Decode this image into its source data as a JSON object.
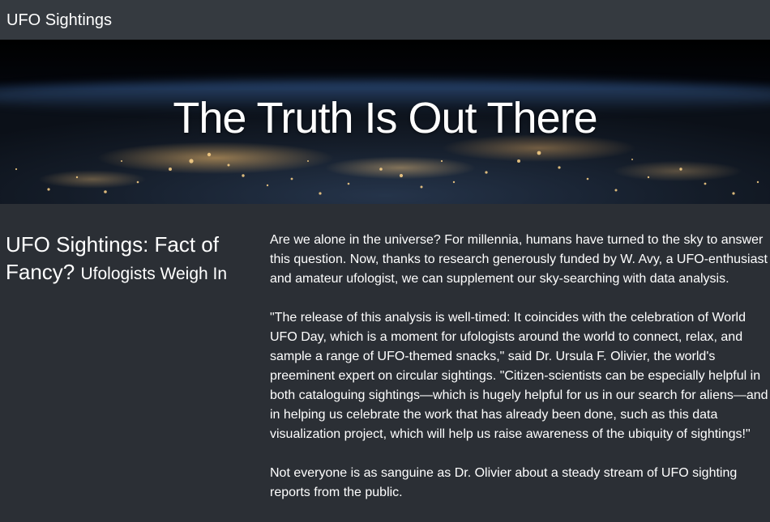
{
  "navbar": {
    "brand": "UFO Sightings"
  },
  "hero": {
    "title": "The Truth Is Out There"
  },
  "sidebar": {
    "heading": "UFO Sightings: Fact of Fancy?",
    "subheading": "Ufologists Weigh In"
  },
  "article": {
    "paragraphs": [
      "Are we alone in the universe? For millennia, humans have turned to the sky to answer this question. Now, thanks to research generously funded by W. Avy, a UFO-enthusiast and amateur ufologist, we can supplement our sky-searching with data analysis.",
      "\"The release of this analysis is well-timed: It coincides with the celebration of World UFO Day, which is a moment for ufologists around the world to connect, relax, and sample a range of UFO-themed snacks,\" said Dr. Ursula F. Olivier, the world's preeminent expert on circular sightings. \"Citizen-scientists can be especially helpful in both cataloguing sightings—which is hugely helpful for us in our search for aliens—and in helping us celebrate the work that has already been done, such as this data visualization project, which will help us raise awareness of the ubiquity of sightings!\"",
      "Not everyone is as sanguine as Dr. Olivier about a steady stream of UFO sighting reports from the public."
    ]
  },
  "colors": {
    "page_background": "#2b2f35",
    "navbar_background": "#353a40",
    "text": "#ffffff"
  }
}
